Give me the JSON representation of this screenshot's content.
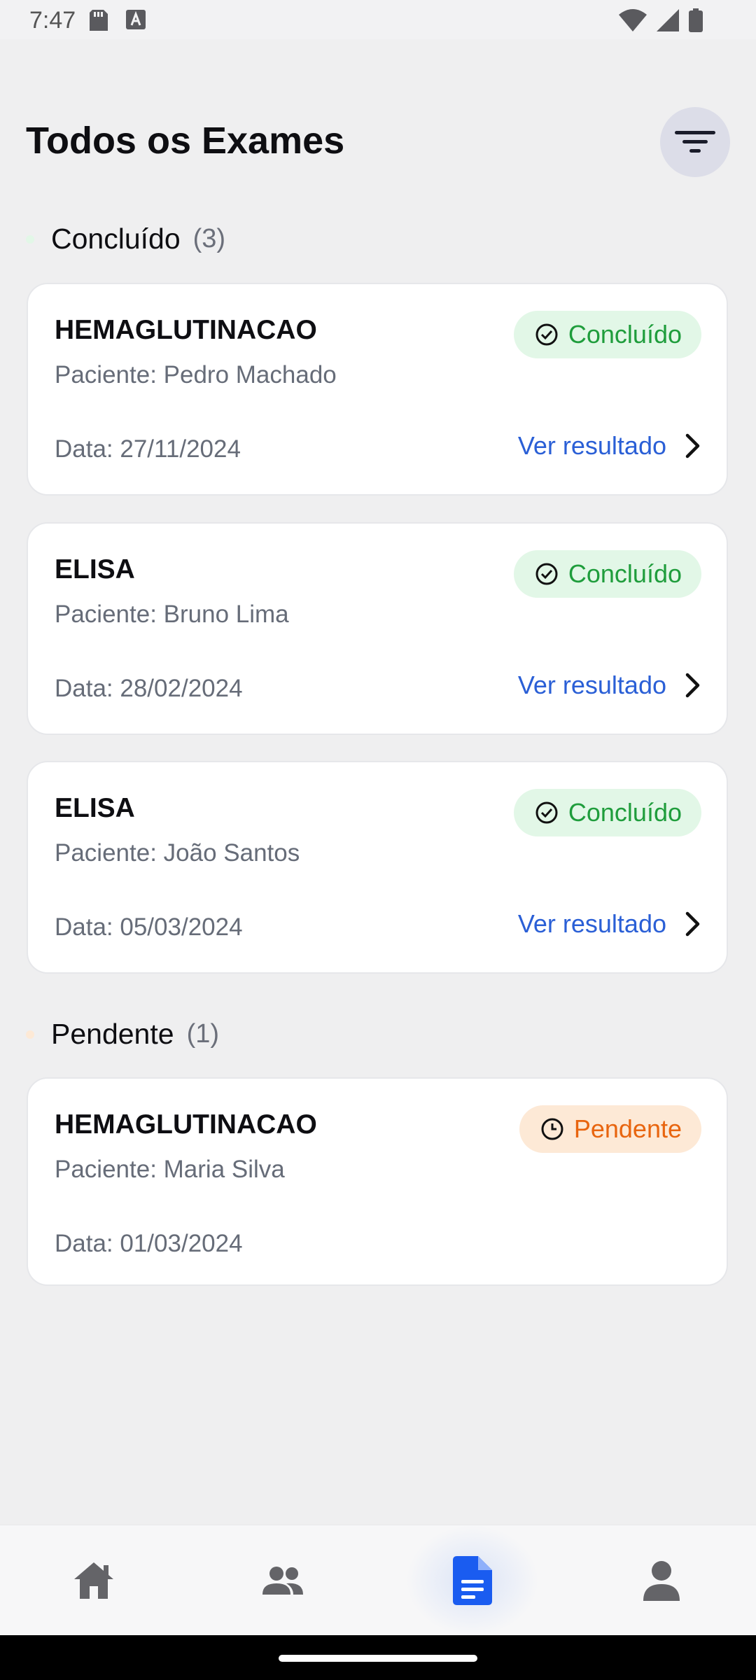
{
  "status_bar": {
    "time": "7:47",
    "icons_left": [
      "sd-card-icon",
      "a-box-icon"
    ],
    "icons_right": [
      "wifi-icon",
      "signal-icon",
      "battery-icon"
    ]
  },
  "header": {
    "title": "Todos os Exames",
    "filter_icon": "filter-icon"
  },
  "sections": [
    {
      "title": "Concluído",
      "count": "(3)",
      "dot_color": "#e2f7e7",
      "items": [
        {
          "exam": "HEMAGLUTINACAO",
          "patient": "Paciente: Pedro Machado",
          "date": "Data: 27/11/2024",
          "status": "Concluído",
          "action": "Ver resultado"
        },
        {
          "exam": "ELISA",
          "patient": "Paciente: Bruno Lima",
          "date": "Data: 28/02/2024",
          "status": "Concluído",
          "action": "Ver resultado"
        },
        {
          "exam": "ELISA",
          "patient": "Paciente: João Santos",
          "date": "Data: 05/03/2024",
          "status": "Concluído",
          "action": "Ver resultado"
        }
      ]
    },
    {
      "title": "Pendente",
      "count": "(1)",
      "dot_color": "#fde9d6",
      "items": [
        {
          "exam": "HEMAGLUTINACAO",
          "patient": "Paciente: Maria Silva",
          "date": "Data: 01/03/2024",
          "status": "Pendente"
        }
      ]
    }
  ],
  "bottom_nav": {
    "items": [
      {
        "icon": "home-icon",
        "active": false
      },
      {
        "icon": "patients-icon",
        "active": false
      },
      {
        "icon": "exams-document-icon",
        "active": true
      },
      {
        "icon": "profile-icon",
        "active": false
      }
    ]
  },
  "colors": {
    "background": "#efeff0",
    "accent": "#1a5cf0",
    "link": "#2a5fd6",
    "done_text": "#1f9d3c",
    "done_bg": "#e2f7e7",
    "pending_text": "#e8650f",
    "pending_bg": "#fde9d6"
  }
}
